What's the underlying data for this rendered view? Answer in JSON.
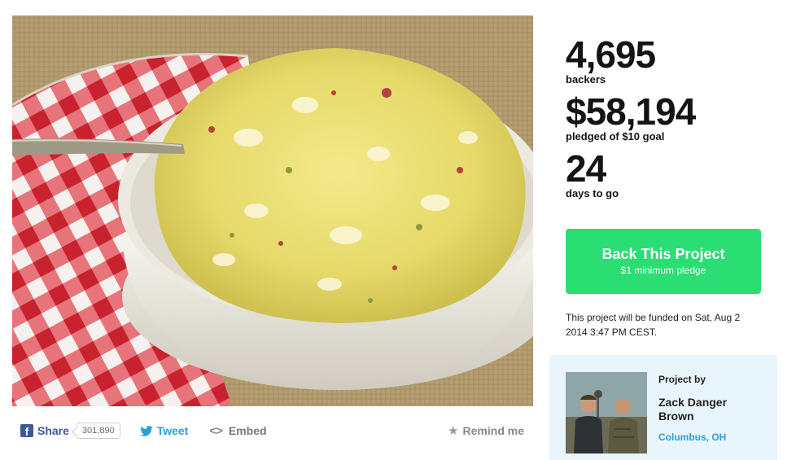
{
  "stats": {
    "backers_count": "4,695",
    "backers_label": "backers",
    "pledged_amount": "$58,194",
    "pledged_label": "pledged of $10 goal",
    "days_count": "24",
    "days_label": "days to go"
  },
  "cta": {
    "title": "Back This Project",
    "subtitle": "$1 minimum pledge",
    "color": "#2bde73"
  },
  "funding_note": "This project will be funded on Sat, Aug 2 2014 3:47 PM CEST.",
  "share_bar": {
    "facebook_label": "Share",
    "facebook_count": "301,890",
    "tweet_label": "Tweet",
    "embed_label": "Embed",
    "remind_label": "Remind me",
    "icons": [
      "facebook-icon",
      "twitter-icon",
      "embed-code-icon",
      "star-icon"
    ]
  },
  "creator": {
    "project_by_label": "Project by",
    "name": "Zack Danger Brown",
    "location": "Columbus, OH"
  },
  "colors": {
    "facebook": "#3b5998",
    "twitter": "#2a9fd8",
    "creator_card_bg": "#e9f5fd"
  }
}
